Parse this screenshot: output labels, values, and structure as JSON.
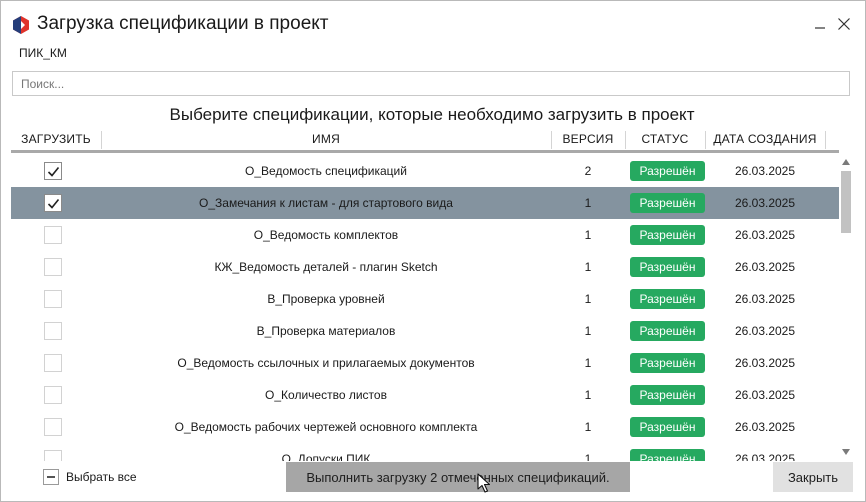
{
  "window": {
    "title": "Загрузка спецификации в проект",
    "project": "ПИК_КМ"
  },
  "search": {
    "placeholder": "Поиск..."
  },
  "heading": "Выберите спецификации, которые необходимо загрузить в проект",
  "columns": {
    "load": "ЗАГРУЗИТЬ",
    "name": "ИМЯ",
    "version": "ВЕРСИЯ",
    "status": "СТАТУС",
    "created": "ДАТА СОЗДАНИЯ"
  },
  "rows": [
    {
      "name": "О_Ведомость спецификаций",
      "version": "2",
      "status": "Разрешён",
      "date": "26.03.2025",
      "checked": true,
      "selected": false
    },
    {
      "name": "О_Замечания к листам - для стартового вида",
      "version": "1",
      "status": "Разрешён",
      "date": "26.03.2025",
      "checked": true,
      "selected": true
    },
    {
      "name": "О_Ведомость комплектов",
      "version": "1",
      "status": "Разрешён",
      "date": "26.03.2025",
      "checked": false,
      "selected": false
    },
    {
      "name": "КЖ_Ведомость деталей - плагин Sketch",
      "version": "1",
      "status": "Разрешён",
      "date": "26.03.2025",
      "checked": false,
      "selected": false
    },
    {
      "name": "В_Проверка уровней",
      "version": "1",
      "status": "Разрешён",
      "date": "26.03.2025",
      "checked": false,
      "selected": false
    },
    {
      "name": "В_Проверка материалов",
      "version": "1",
      "status": "Разрешён",
      "date": "26.03.2025",
      "checked": false,
      "selected": false
    },
    {
      "name": "О_Ведомость ссылочных и прилагаемых документов",
      "version": "1",
      "status": "Разрешён",
      "date": "26.03.2025",
      "checked": false,
      "selected": false
    },
    {
      "name": "О_Количество листов",
      "version": "1",
      "status": "Разрешён",
      "date": "26.03.2025",
      "checked": false,
      "selected": false
    },
    {
      "name": "О_Ведомость рабочих чертежей основного комплекта",
      "version": "1",
      "status": "Разрешён",
      "date": "26.03.2025",
      "checked": false,
      "selected": false
    },
    {
      "name": "О_Допуски ПИК",
      "version": "1",
      "status": "Разрешён",
      "date": "26.03.2025",
      "checked": false,
      "selected": false
    }
  ],
  "footer": {
    "select_all": "Выбрать все",
    "run": "Выполнить загрузку 2 отмеченных спецификаций.",
    "close": "Закрыть"
  },
  "colors": {
    "status_green": "#26a960",
    "selected_row": "#84939f",
    "logo_red": "#e0332b",
    "logo_blue": "#243d7a"
  },
  "icons": {
    "logo": "app-logo-icon",
    "minimize": "minimize-icon",
    "close": "close-icon",
    "check": "check-icon",
    "scroll_up": "chevron-up-icon",
    "scroll_down": "chevron-down-icon",
    "cursor": "mouse-cursor-icon"
  }
}
